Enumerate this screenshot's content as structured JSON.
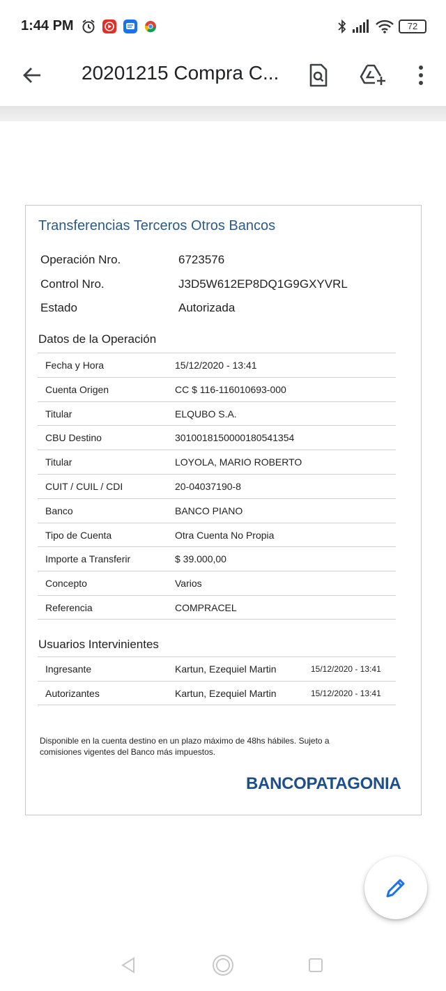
{
  "status_bar": {
    "time": "1:44 PM",
    "battery": "72",
    "icons": [
      "alarm-icon",
      "youtube-music-icon",
      "messages-icon",
      "chrome-icon",
      "bluetooth-icon",
      "signal-icon",
      "wifi-icon",
      "battery-icon"
    ]
  },
  "app_bar": {
    "title": "20201215 Compra C...",
    "icons": [
      "back-arrow-icon",
      "find-in-page-icon",
      "add-to-drive-icon",
      "more-vert-icon"
    ]
  },
  "document": {
    "heading": "Transferencias Terceros Otros Bancos",
    "summary": [
      {
        "label": "Operación Nro.",
        "value": "6723576"
      },
      {
        "label": "Control Nro.",
        "value": "J3D5W612EP8DQ1G9GXYVRL"
      },
      {
        "label": "Estado",
        "value": "Autorizada"
      }
    ],
    "operation_title": "Datos de la Operación",
    "operation_rows": [
      {
        "label": "Fecha y Hora",
        "value": "15/12/2020 - 13:41"
      },
      {
        "label": "Cuenta Origen",
        "value": "CC $ 116-116010693-000"
      },
      {
        "label": "Titular",
        "value": "ELQUBO S.A."
      },
      {
        "label": "CBU Destino",
        "value": "3010018150000180541354"
      },
      {
        "label": "Titular",
        "value": "LOYOLA, MARIO ROBERTO"
      },
      {
        "label": "CUIT / CUIL / CDI",
        "value": "20-04037190-8"
      },
      {
        "label": "Banco",
        "value": "BANCO PIANO"
      },
      {
        "label": "Tipo de Cuenta",
        "value": "Otra Cuenta No Propia"
      },
      {
        "label": "Importe a Transferir",
        "value": "$ 39.000,00"
      },
      {
        "label": "Concepto",
        "value": "Varios"
      },
      {
        "label": "Referencia",
        "value": "COMPRACEL"
      }
    ],
    "users_title": "Usuarios Intervinientes",
    "users_rows": [
      {
        "role": "Ingresante",
        "name": "Kartun, Ezequiel Martin",
        "date": "15/12/2020 - 13:41"
      },
      {
        "role": "Autorizantes",
        "name": "Kartun, Ezequiel Martin",
        "date": "15/12/2020 - 13:41"
      }
    ],
    "disclaimer": "Disponible en la cuenta destino en un plazo máximo de 48hs hábiles. Sujeto a comisiones vigentes del Banco más impuestos.",
    "bank_logo": "BANCOPATAGONIA"
  },
  "fab": {
    "icon": "edit-pencil-icon"
  },
  "nav_bar": {
    "icons": [
      "nav-back-icon",
      "nav-home-icon",
      "nav-recents-icon"
    ]
  },
  "colors": {
    "heading": "#2b5b86",
    "logo": "#1d4f8c",
    "fab_icon": "#1a73e8"
  }
}
